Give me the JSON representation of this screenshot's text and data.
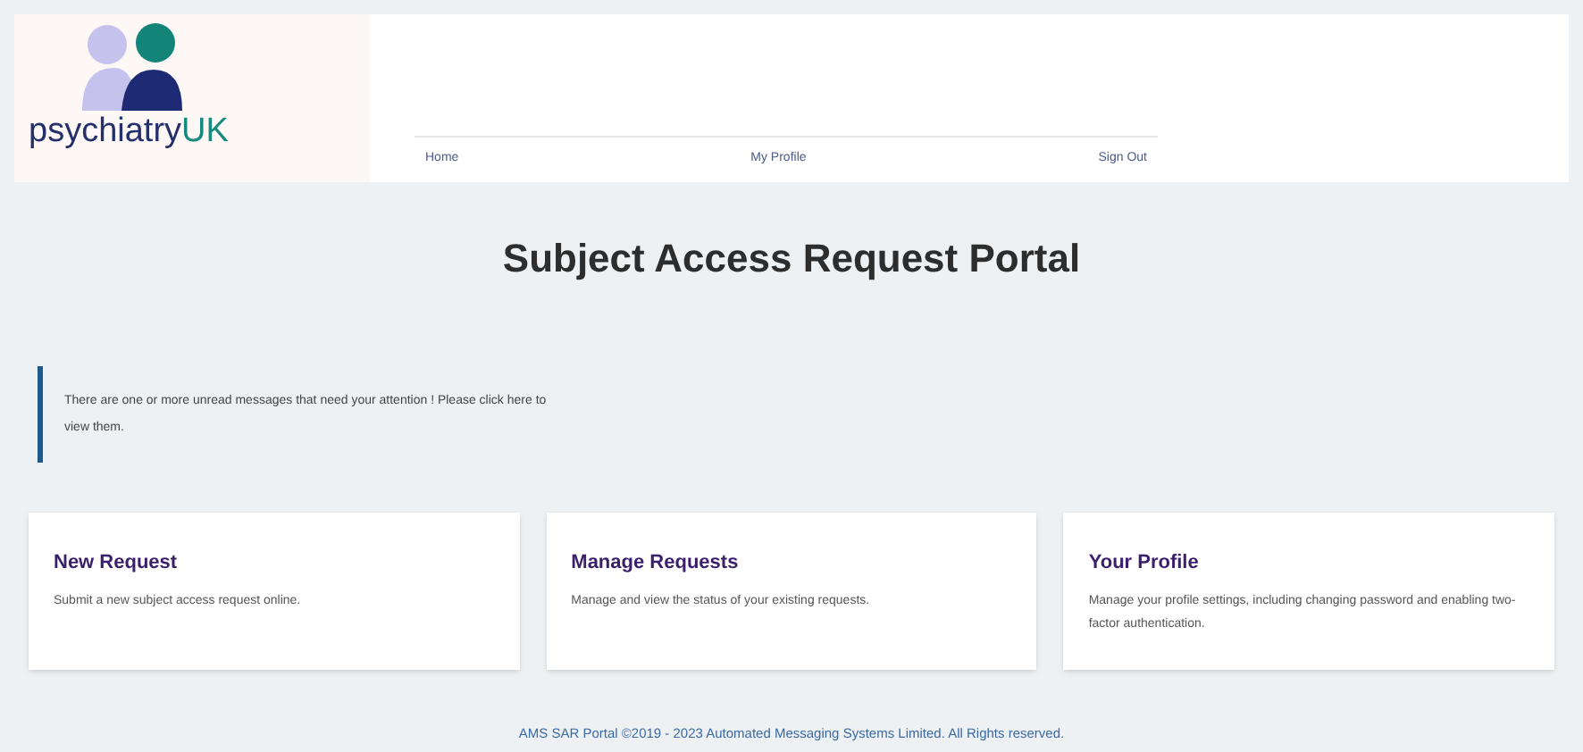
{
  "logo": {
    "word": "psychiatry",
    "accent": "UK"
  },
  "nav": [
    "Home",
    "My Profile",
    "Sign Out"
  ],
  "title": "Subject Access Request Portal",
  "alert": {
    "text": "There are one or more unread messages that need your attention ! Please click here to view them."
  },
  "cards": [
    {
      "title": "New Request",
      "text": "Submit a new subject access request online."
    },
    {
      "title": "Manage Requests",
      "text": "Manage and view the status of your existing requests."
    },
    {
      "title": "Your Profile",
      "text": "Manage your profile settings, including changing password and enabling two-factor authentication."
    }
  ],
  "footer": "AMS SAR Portal ©2019 - 2023 Automated Messaging Systems Limited. All Rights reserved."
}
